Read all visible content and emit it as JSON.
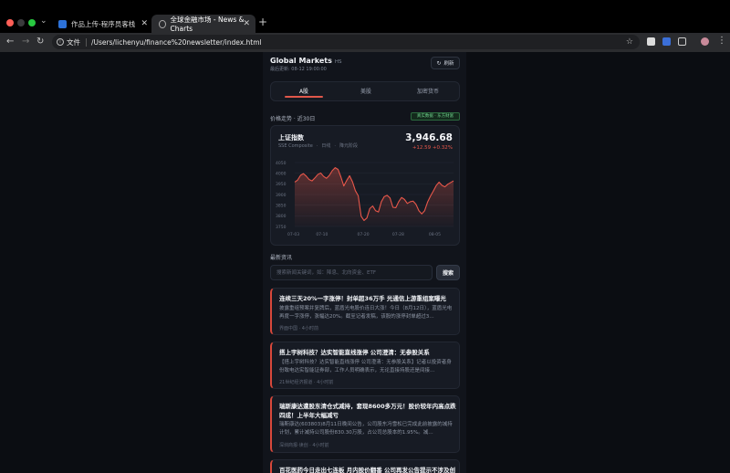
{
  "browser": {
    "tabs": [
      {
        "title": "作品上传-程序员客栈",
        "active": false
      },
      {
        "title": "全球金融市场 - News & Charts",
        "active": true
      }
    ],
    "address": {
      "scheme_label": "文件",
      "url": "/Users/lichenyu/finance%20newsletter/index.html"
    },
    "icons": [
      "chevron-down-icon",
      "close-icon",
      "plus-icon",
      "back-icon",
      "forward-icon",
      "reload-icon",
      "info-icon",
      "star-icon",
      "extension-icon",
      "avatar",
      "menu-icon"
    ]
  },
  "header": {
    "title": "Global Markets",
    "title_suffix": "HS",
    "updated": "最后更新: 08-12 19:00:00",
    "refresh_label": "刷新"
  },
  "markets": {
    "tabs": [
      "A股",
      "美股",
      "加密货币"
    ],
    "active_index": 0
  },
  "trend": {
    "label": "价格走势 · 近30日",
    "badge": "真实数据 · 东方财富"
  },
  "index_card": {
    "name": "上证指数",
    "code": "SSE Composite",
    "tags": [
      "日线",
      "降元阶段"
    ],
    "price": "3,946.68",
    "change": "+12.59  +0.32%"
  },
  "chart_data": {
    "type": "area",
    "title": "",
    "y_ticks": [
      "4050",
      "4000",
      "3950",
      "3900",
      "3850",
      "3800",
      "3750"
    ],
    "x_ticks": [
      "07-03",
      "07-10",
      "07-20",
      "07-28",
      "08-05"
    ],
    "ylim": [
      3750,
      4050
    ],
    "grid": true,
    "color": "#e8574a",
    "values": [
      3958,
      3968,
      3990,
      3998,
      3986,
      3970,
      3964,
      3978,
      3994,
      4001,
      3985,
      3976,
      3990,
      4012,
      4026,
      4018,
      3982,
      3940,
      3966,
      3988,
      3960,
      3918,
      3894,
      3798,
      3778,
      3790,
      3834,
      3846,
      3824,
      3818,
      3866,
      3890,
      3896,
      3884,
      3840,
      3838,
      3866,
      3886,
      3877,
      3858,
      3866,
      3869,
      3854,
      3824,
      3809,
      3824,
      3864,
      3892,
      3916,
      3942,
      3958,
      3943,
      3936,
      3948,
      3956,
      3964
    ]
  },
  "news": {
    "label": "最新资讯",
    "search_placeholder": "搜索新闻关键词，如：降息、北向资金、ETF",
    "search_button": "搜索",
    "items": [
      {
        "title": "连续三天20%一字涨停！封单超36万手 光通信上游重组案曝光",
        "body": "披露重组预案并复牌后，蓝盾光电股价连日大涨！今日（8月12日），蓝盾光电再度一字涨停，涨幅达20%。截至记者发稿，该股的涨停封单超过3…",
        "source": "界面中国",
        "time": "4小时前"
      },
      {
        "title": "搭上宇树科技？达实智能直线涨停 公司澄清：无参股关系",
        "body": "【搭上宇树科技？达实智能直线涨停 公司澄清：无参股关系】记者以投资者身份致电达实智能证券部，工作人员明确表示，无论直接持股还是间接…",
        "source": "21世纪经济报道",
        "time": "4小时前"
      },
      {
        "title": "瑞斯康达遭股东清仓式减持，套现8600多万元！股价较年内高点跌四成！上半年大幅减亏",
        "body": "瑞斯康达(603803)8月11日晚间公告，公司股东冯雪松已完成此前披露的减持计划，累计减持公司股份830.30万股，占公司总股本的1.95%。减…",
        "source": "深圳商报·读创",
        "time": "4小时前"
      },
      {
        "title": "百花医药今日走出七连板 月内股价翻番 公司再发公告提示不涉及创新药",
        "body": "",
        "source": "",
        "time": ""
      }
    ]
  }
}
